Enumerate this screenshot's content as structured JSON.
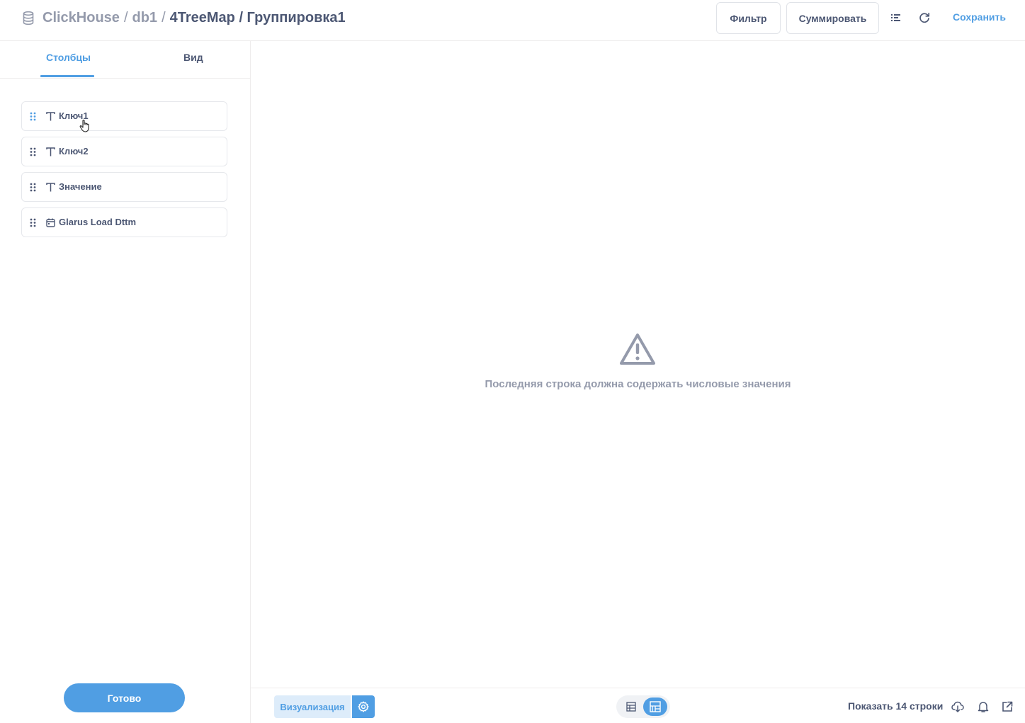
{
  "header": {
    "breadcrumb": {
      "database": "ClickHouse",
      "sep1": "/",
      "schema": "db1",
      "sep2": "/",
      "title": "4TreeMap / Группировка1"
    },
    "filter_label": "Фильтр",
    "summarize_label": "Суммировать",
    "save_label": "Сохранить"
  },
  "sidebar": {
    "tabs": [
      {
        "label": "Столбцы",
        "active": true
      },
      {
        "label": "Вид",
        "active": false
      }
    ],
    "columns": [
      {
        "label": "Ключ1",
        "type_icon": "text-type-icon"
      },
      {
        "label": "Ключ2",
        "type_icon": "text-type-icon"
      },
      {
        "label": "Значение",
        "type_icon": "text-type-icon"
      },
      {
        "label": "Glarus Load Dttm",
        "type_icon": "calendar-icon"
      }
    ],
    "done_label": "Готово"
  },
  "main": {
    "message": "Последняя строка должна содержать числовые значения"
  },
  "footer": {
    "visualization_label": "Визуализация",
    "rows_label": "Показать 14 строки"
  },
  "colors": {
    "accent": "#509ee3",
    "text_dark": "#4c5773",
    "text_muted": "#949aab",
    "border": "#eeecec"
  }
}
